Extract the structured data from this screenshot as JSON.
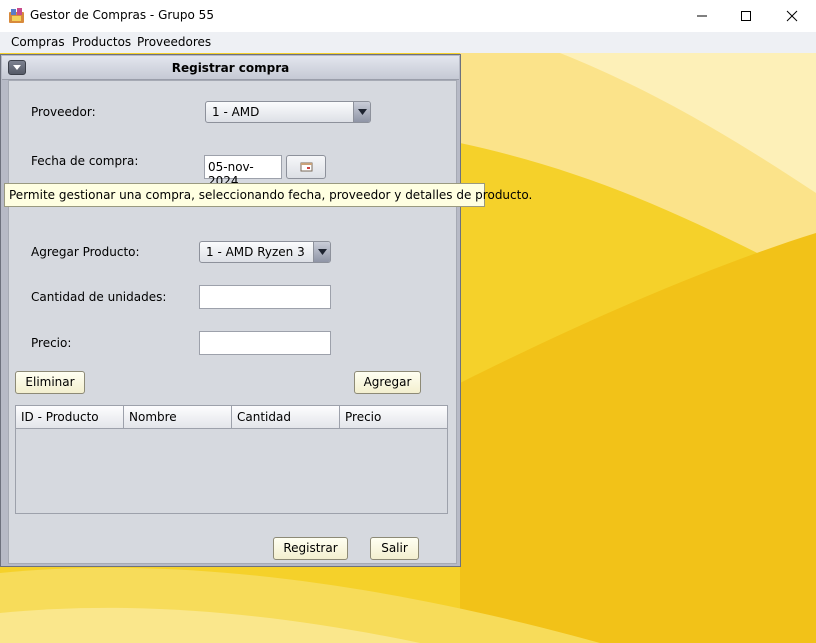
{
  "window": {
    "title": "Gestor de Compras - Grupo 55"
  },
  "menubar": {
    "items": [
      "Compras",
      "Productos",
      "Proveedores"
    ]
  },
  "frame": {
    "title": "Registrar compra",
    "proveedor_label": "Proveedor:",
    "proveedor_value": "1 - AMD",
    "fecha_label": "Fecha de compra:",
    "fecha_value": "05-nov-2024",
    "agregar_producto_label": "Agregar Producto:",
    "producto_value": "1 - AMD Ryzen 3",
    "cantidad_label": "Cantidad de unidades:",
    "cantidad_value": "",
    "precio_label": "Precio:",
    "precio_value": "",
    "eliminar_label": "Eliminar",
    "agregar_label": "Agregar",
    "registrar_label": "Registrar",
    "salir_label": "Salir",
    "table_columns": [
      "ID - Producto",
      "Nombre",
      "Cantidad",
      "Precio"
    ]
  },
  "tooltip": {
    "text": "Permite gestionar una compra, seleccionando fecha, proveedor y detalles de producto."
  },
  "colors": {
    "desktop": "#f4cf22",
    "button": "#f8f5dc",
    "frame": "#d6d9df"
  },
  "icons": [
    "app-icon",
    "minimize-icon",
    "maximize-icon",
    "close-icon",
    "frame-menu-icon",
    "chevron-down-icon",
    "calendar-icon"
  ]
}
